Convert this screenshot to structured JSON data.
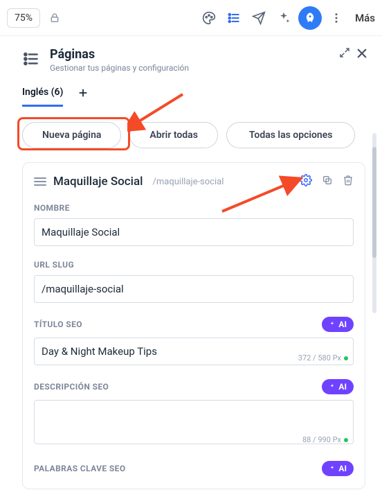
{
  "topbar": {
    "zoom": "75%",
    "more_label": "Más"
  },
  "panel": {
    "title": "Páginas",
    "subtitle": "Gestionar tus páginas y configuración"
  },
  "language_tab": {
    "label": "Inglés (6)"
  },
  "actions": {
    "new_page": "Nueva página",
    "open_all": "Abrir todas",
    "all_options": "Todas las opciones"
  },
  "page": {
    "title": "Maquillaje Social",
    "slug_display": "/maquillaje-social"
  },
  "fields": {
    "name": {
      "label": "NOMBRE",
      "value": "Maquillaje Social"
    },
    "url_slug": {
      "label": "URL SLUG",
      "value": "/maquillaje-social"
    },
    "seo_title": {
      "label": "TÍTULO SEO",
      "value": "Day & Night Makeup Tips",
      "counter": "372 / 580 Px"
    },
    "seo_desc": {
      "label": "DESCRIPCIÓN SEO",
      "value": "",
      "counter": "88 / 990 Px"
    },
    "seo_keywords": {
      "label": "PALABRAS CLAVE SEO"
    }
  },
  "ai_chip": "AI"
}
